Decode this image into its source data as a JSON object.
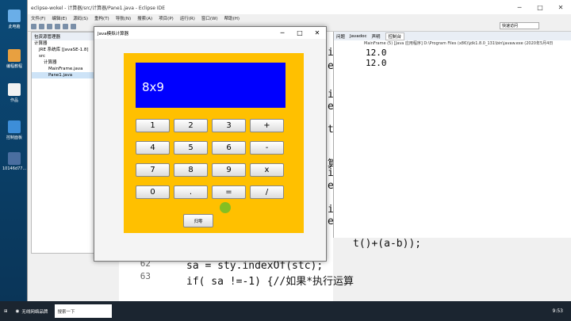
{
  "desktop": {
    "icons": [
      {
        "label": "此电脑",
        "color": "#6aaee8"
      },
      {
        "label": "编程教程",
        "color": "#e8a040"
      },
      {
        "label": "作品",
        "color": "#f2f2f2"
      },
      {
        "label": "控制面板",
        "color": "#3d8ed8"
      },
      {
        "label": "10146d77...",
        "color": "#4a6ea0"
      }
    ]
  },
  "eclipse": {
    "title": "eclipse-wokel - 计算器/src/计算器/Pane1.java - Eclipse IDE",
    "menus": [
      "文件(F)",
      "编辑(E)",
      "源码(S)",
      "重构(T)",
      "导航(N)",
      "搜索(A)",
      "项目(P)",
      "运行(R)",
      "窗口(W)",
      "帮助(H)"
    ],
    "quick_access": "快速访问",
    "package_explorer": {
      "title": "包资源管理器",
      "items": [
        "计算器",
        "JRE 系统库 [JavaSE-1.8]",
        "src",
        "计算器",
        "MainFrame.java",
        "Pane1.java"
      ]
    },
    "console": {
      "tabs": [
        "问题",
        "Javadoc",
        "声明",
        "控制台"
      ],
      "selected_tab": "控制台",
      "info": "MainFrame (5) [Java 应用程序] D:\\Program Files (x86)\\jdk1.8.0_131\\bin\\javaw.exe (2020年5月4日",
      "output": [
        "12.0",
        "12.0"
      ]
    },
    "code": {
      "lines": [
        {
          "num": "62",
          "text": "sa = sty.indexOf(stc);"
        },
        {
          "num": "63",
          "text": "if( sa !=-1) {//如果*执行运算"
        }
      ],
      "fragments": [
        "in",
        "eD",
        "in",
        "eD",
        "t(",
        "算",
        "in",
        "eD",
        "in",
        "eD",
        "t()+(a-b));"
      ]
    }
  },
  "calculator": {
    "title": "Java模拟计算器",
    "display": "8x9",
    "keys": [
      [
        "1",
        "2",
        "3",
        "+"
      ],
      [
        "4",
        "5",
        "6",
        "-"
      ],
      [
        "7",
        "8",
        "9",
        "x"
      ],
      [
        "0",
        ".",
        "=",
        "/"
      ]
    ],
    "clear_label": "归零"
  },
  "taskbar": {
    "task": "无线网络品牌",
    "search": "搜索一下",
    "time": "9:53"
  }
}
